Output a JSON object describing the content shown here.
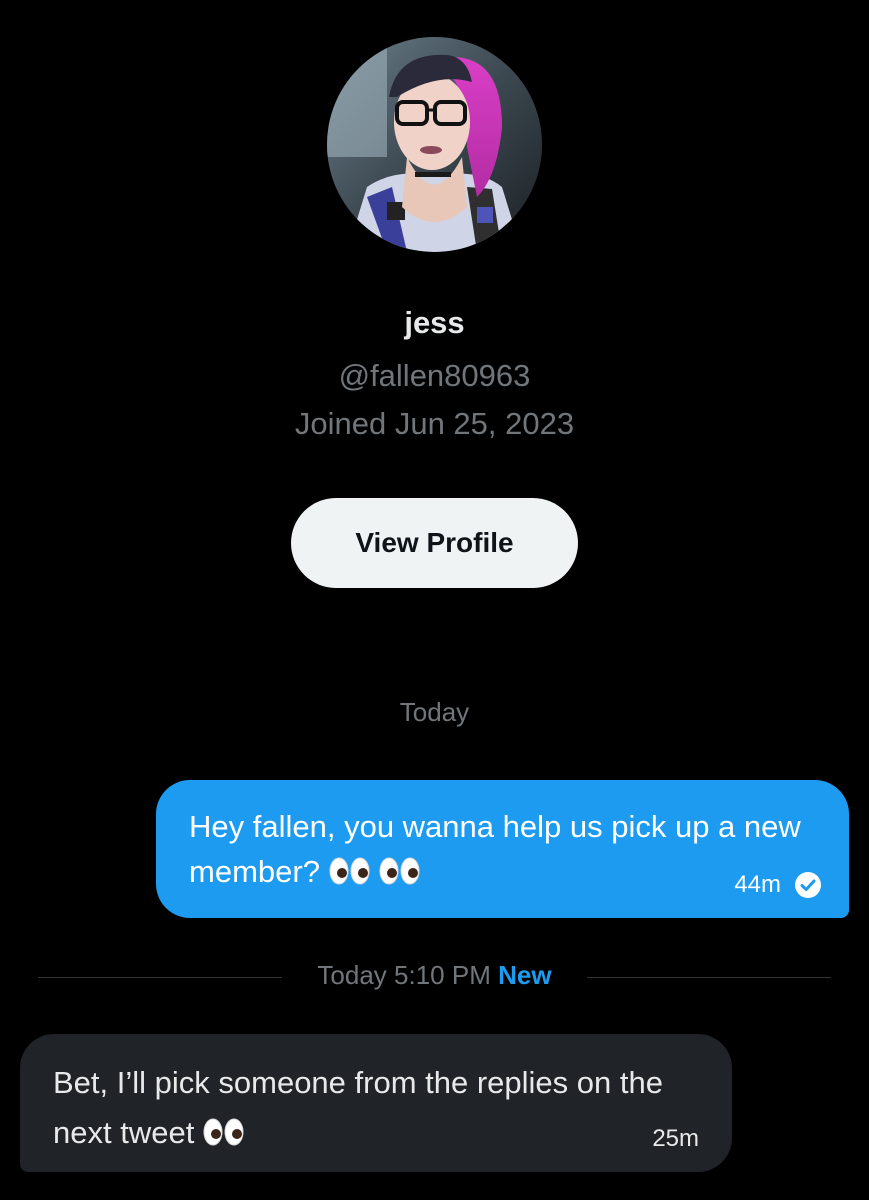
{
  "profile": {
    "name": "jess",
    "handle": "@fallen80963",
    "joined": "Joined Jun 25, 2023",
    "view_profile_label": "View Profile"
  },
  "conversation": {
    "date_label": "Today",
    "outgoing_message": {
      "text": "Hey fallen, you wanna help us pick up a new member?",
      "emoji": "👀👀",
      "time": "44m",
      "status_icon": "seen-check-icon"
    },
    "divider": {
      "text": "Today 5:10 PM",
      "new_label": "New"
    },
    "incoming_message": {
      "text": "Bet, I’ll pick someone from the replies on the next tweet",
      "emoji": "👀",
      "time": "25m"
    }
  },
  "colors": {
    "background": "#000000",
    "accent": "#1d9bf0",
    "incoming_bubble": "#202327",
    "secondary_text": "#71767b"
  }
}
